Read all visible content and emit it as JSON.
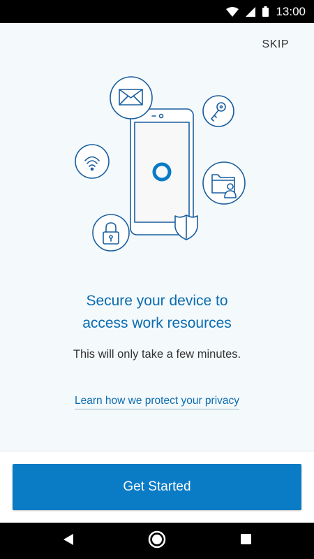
{
  "status_bar": {
    "time": "13:00",
    "icons": [
      "wifi-icon",
      "signal-icon",
      "battery-icon"
    ]
  },
  "header": {
    "skip_label": "SKIP"
  },
  "illustration": {
    "icons": [
      "email-icon",
      "key-icon",
      "wifi-icon",
      "folder-user-icon",
      "lock-icon",
      "phone-icon",
      "shield-icon",
      "company-logo-icon"
    ]
  },
  "main": {
    "title_line1": "Secure your device to",
    "title_line2": "access work resources",
    "subtitle": "This will only take a few minutes.",
    "privacy_link": "Learn how we protect your privacy"
  },
  "footer": {
    "cta_label": "Get Started"
  },
  "nav_bar": {
    "icons": [
      "back-icon",
      "home-icon",
      "recents-icon"
    ]
  },
  "colors": {
    "accent": "#0a7bc5",
    "title": "#0a6cb0",
    "background": "#f4f9fc",
    "outline": "#1a5f9e"
  }
}
